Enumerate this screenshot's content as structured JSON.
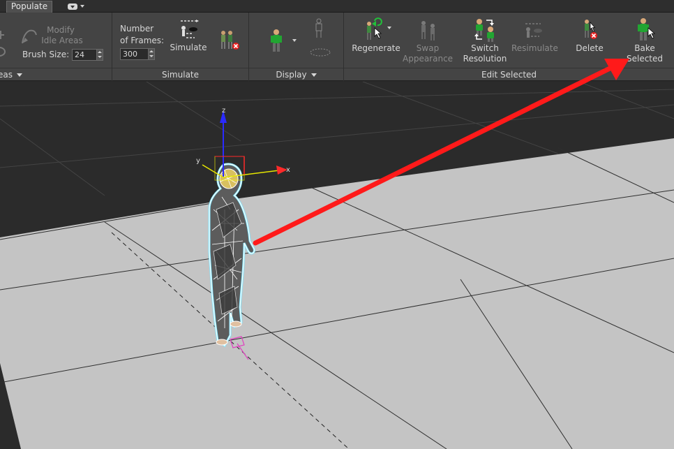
{
  "app": {
    "active_tab": "Populate"
  },
  "ribbon": {
    "idle_areas": {
      "modify_label_1": "Modify",
      "modify_label_2": "Idle Areas",
      "brush_size_label": "Brush Size:",
      "brush_size_value": "24",
      "footer_label": "eas"
    },
    "simulate": {
      "frames_label_1": "Number",
      "frames_label_2": "of Frames:",
      "frames_value": "300",
      "simulate_label": "Simulate",
      "footer_label": "Simulate"
    },
    "display": {
      "footer_label": "Display"
    },
    "edit_selected": {
      "regenerate_label": "Regenerate",
      "swap_label_1": "Swap",
      "swap_label_2": "Appearance",
      "switch_label_1": "Switch",
      "switch_label_2": "Resolution",
      "resimulate_label": "Resimulate",
      "delete_label": "Delete",
      "bake_label_1": "Bake",
      "bake_label_2": "Selected",
      "footer_label": "Edit Selected"
    }
  },
  "viewport": {
    "gizmo_labels": {
      "x": "x",
      "y": "y",
      "z": "z"
    },
    "annotation_color": "#ff1a1a",
    "selection_color": "#7fe6ff"
  },
  "colors": {
    "ribbon_bg": "#444444",
    "floor": "#c4c4c4",
    "background_plane": "#2b2b2b",
    "gizmo_x": "#ff2a2a",
    "gizmo_y": "#e6e600",
    "gizmo_z": "#2a2aff"
  }
}
